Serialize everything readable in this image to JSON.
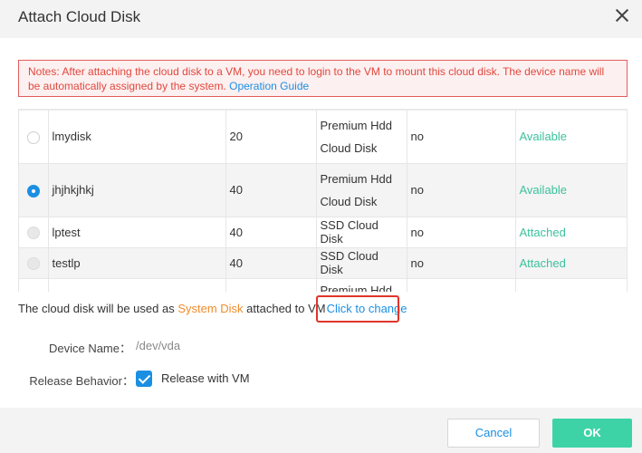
{
  "dialog": {
    "title": "Attach Cloud Disk"
  },
  "notice": {
    "text": "Notes: After attaching the cloud disk to a VM, you need to login to the VM to mount this cloud disk. The device name will be automatically assigned by the system. ",
    "link": "Operation Guide"
  },
  "disks": [
    {
      "name": "lmydisk",
      "size": "20",
      "type_line1": "Premium Hdd",
      "type_line2": "Cloud Disk",
      "shared": "no",
      "status": "Available",
      "selected": false,
      "disabled": false
    },
    {
      "name": "jhjhkjhkj",
      "size": "40",
      "type_line1": "Premium Hdd",
      "type_line2": "Cloud Disk",
      "shared": "no",
      "status": "Available",
      "selected": true,
      "disabled": false
    },
    {
      "name": "lptest",
      "size": "40",
      "type_line1": "SSD Cloud Disk",
      "type_line2": "",
      "shared": "no",
      "status": "Attached",
      "selected": false,
      "disabled": true
    },
    {
      "name": "testlp",
      "size": "40",
      "type_line1": "SSD Cloud Disk",
      "type_line2": "",
      "shared": "no",
      "status": "Attached",
      "selected": false,
      "disabled": true
    },
    {
      "name": "",
      "size": "",
      "type_line1": "Premium Hdd",
      "type_line2": "",
      "shared": "",
      "status": "",
      "selected": false,
      "disabled": false
    }
  ],
  "usage": {
    "prefix": "The cloud disk will be used as ",
    "disk_role": "System Disk",
    "middle": " attached to VM",
    "change_link": "Click to change"
  },
  "device": {
    "label": "Device Name：",
    "value": "/dev/vda"
  },
  "release": {
    "label": "Release Behavior：",
    "option": "Release with VM",
    "checked": true
  },
  "buttons": {
    "cancel": "Cancel",
    "ok": "OK"
  },
  "colors": {
    "accent": "#1a8fe3",
    "status_green": "#3cc19c",
    "notice_red": "#e0483e",
    "ok_button": "#3ed3a6",
    "role_orange": "#f08c2e"
  }
}
